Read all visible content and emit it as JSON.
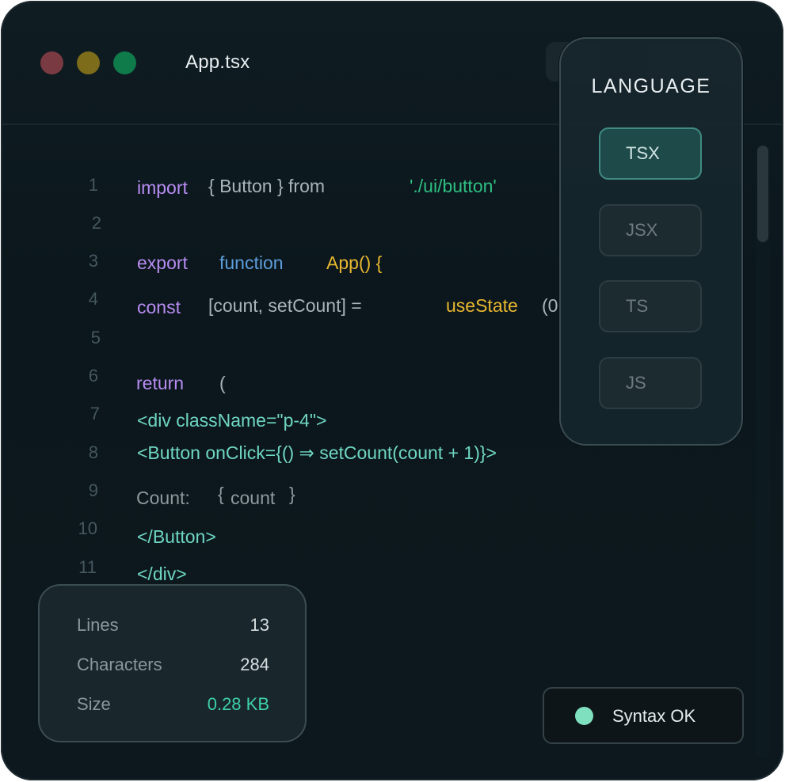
{
  "window": {
    "title": "App.tsx",
    "traffic_lights": [
      "#7a3a42",
      "#7d6c19",
      "#0f7a4a"
    ]
  },
  "editor": {
    "line_numbers": [
      "1",
      "2",
      "3",
      "4",
      "5",
      "6",
      "7",
      "8",
      "9",
      "10",
      "11"
    ],
    "lines": {
      "l1": {
        "import": "import",
        "rest": "{ Button } from",
        "path": "'./ui/button'"
      },
      "l3": {
        "export": "export",
        "function": "function",
        "name": "App() {"
      },
      "l4": {
        "const": "const",
        "decl": "[count, setCount] =",
        "call": "useState",
        "arg": "(0"
      },
      "l6": {
        "return": "return",
        "paren": "("
      },
      "l7": {
        "jsx": "<div className=\"p-4\">"
      },
      "l8": {
        "jsx": "<Button onClick={() ⇒ setCount(count + 1)}>"
      },
      "l9": {
        "label": "Count:",
        "expr_open": "{",
        "expr": "count",
        "expr_close": "}"
      },
      "l10": {
        "jsx": "</Button>"
      },
      "l11": {
        "jsx": "</div>"
      }
    }
  },
  "language_panel": {
    "title": "LANGUAGE",
    "options": [
      "TSX",
      "JSX",
      "TS",
      "JS"
    ],
    "selected": "TSX"
  },
  "stats": {
    "lines_label": "Lines",
    "lines_value": "13",
    "chars_label": "Characters",
    "chars_value": "284",
    "size_label": "Size",
    "size_value": "0.28 KB"
  },
  "status": {
    "text": "Syntax OK",
    "color": "#7fe0c0"
  },
  "colors": {
    "keyword": "#b78cf2",
    "function_keyword": "#5d9ddb",
    "identifier": "#e8b730",
    "string": "#2fbf82",
    "jsx": "#6fd6c3",
    "accent": "#3ecfa8"
  }
}
